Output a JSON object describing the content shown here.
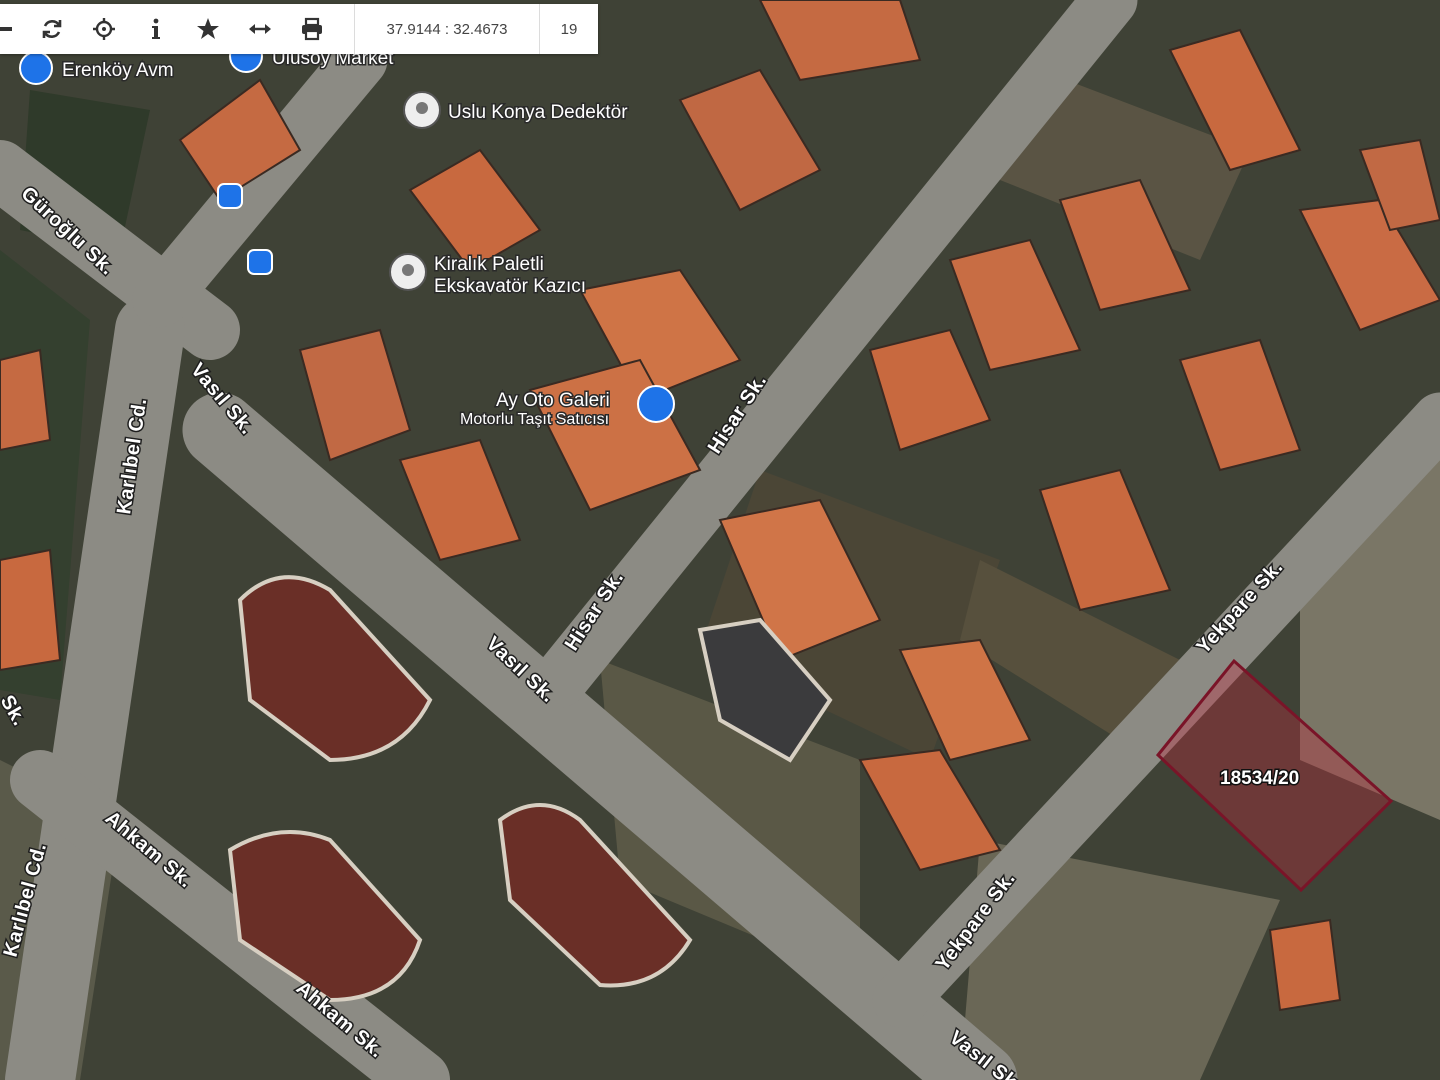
{
  "toolbar": {
    "buttons": [
      {
        "name": "collapse",
        "icon": "minus-icon"
      },
      {
        "name": "refresh",
        "icon": "refresh-icon"
      },
      {
        "name": "locate",
        "icon": "crosshair-icon"
      },
      {
        "name": "info",
        "icon": "info-icon"
      },
      {
        "name": "favorite",
        "icon": "star-icon"
      },
      {
        "name": "measure",
        "icon": "arrows-horizontal-icon"
      },
      {
        "name": "print",
        "icon": "printer-icon"
      }
    ],
    "coordinates": "37.9144 : 32.4673",
    "zoom": "19"
  },
  "pois": [
    {
      "label": "Erenköy Avm",
      "icon": "shopping-cart-icon"
    },
    {
      "label": "Ulusoy Market",
      "icon": "shopping-cart-icon"
    },
    {
      "label": "Uslu Konya Dedektör",
      "icon": "map-pin-icon"
    },
    {
      "label": "Kiralık Paletli",
      "label2": "Ekskavatör Kazıcı",
      "icon": "map-pin-icon"
    },
    {
      "label": "Ay Oto Galeri",
      "label2": "Motorlu Taşıt Satıcısı",
      "icon": "car-dealer-icon"
    }
  ],
  "streets": [
    "Güroğlu Sk.",
    "Vasıl Sk.",
    "Karlıbel Cd.",
    "Hisar Sk.",
    "Hisar Sk.",
    "Vasıl Sk.",
    "Yekpare Sk.",
    "Yekpare Sk.",
    "Ahkam Sk.",
    "Karlıbel Cd.",
    "Ahkam Sk.",
    "Vasıl Sk.",
    "Sk."
  ],
  "parcel": {
    "label": "18534/20",
    "stroke": "#7a1428",
    "fill": "#c2283c"
  },
  "colors": {
    "road": "#8e8d86",
    "roof_orange": "#c8693f",
    "roof_dark": "#6a2f27",
    "ground": "#4a4a3c",
    "bus_stop": "#1e73e8"
  }
}
